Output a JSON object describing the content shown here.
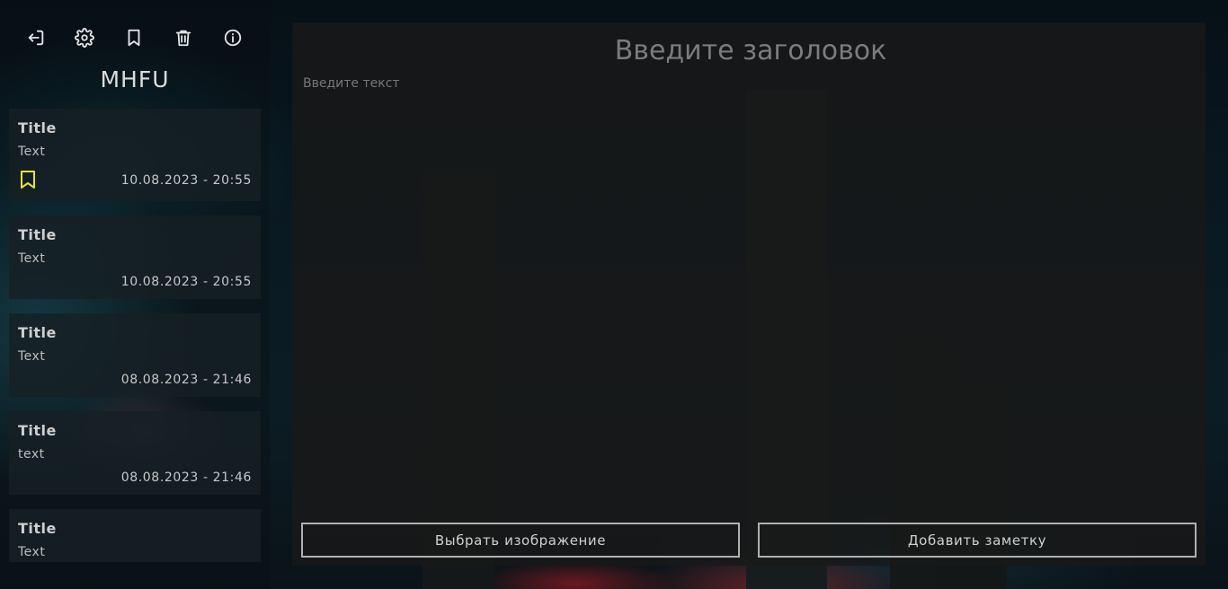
{
  "app": {
    "title": "MHFU"
  },
  "toolbar": {
    "icons": [
      "logout-icon",
      "settings-icon",
      "bookmark-icon",
      "trash-icon",
      "info-icon"
    ]
  },
  "notes": [
    {
      "title": "Title",
      "text": "Text",
      "date": "10.08.2023 - 20:55",
      "bookmarked": true
    },
    {
      "title": "Title",
      "text": "Text",
      "date": "10.08.2023 - 20:55",
      "bookmarked": false
    },
    {
      "title": "Title",
      "text": "Text",
      "date": "08.08.2023 - 21:46",
      "bookmarked": false
    },
    {
      "title": "Title",
      "text": "text",
      "date": "08.08.2023 - 21:46",
      "bookmarked": false
    },
    {
      "title": "Title",
      "text": "Text",
      "date": "",
      "bookmarked": false
    }
  ],
  "editor": {
    "title_placeholder": "Введите заголовок",
    "text_placeholder": "Введите текст",
    "choose_image_label": "Выбрать изображение",
    "add_note_label": "Добавить заметку"
  },
  "colors": {
    "bookmark_active": "#e8e233",
    "button_border": "#b0b0b0"
  }
}
